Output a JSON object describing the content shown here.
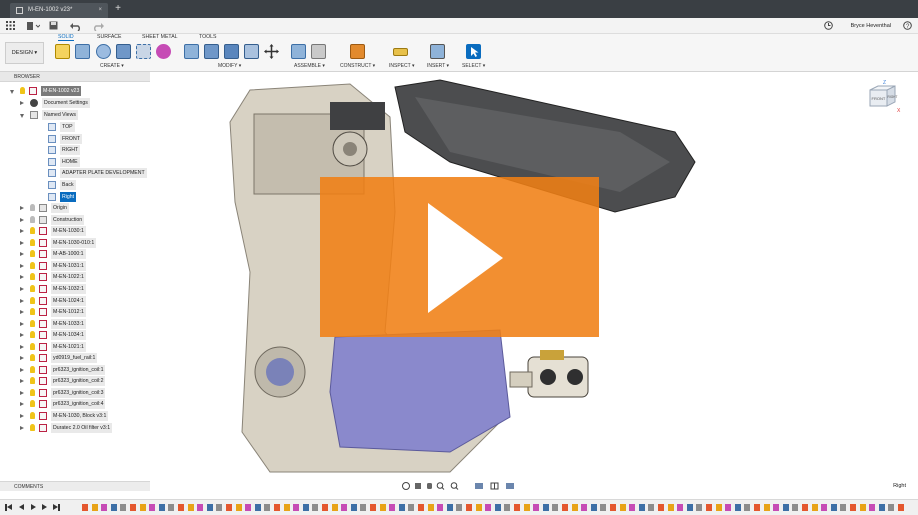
{
  "document_tab": {
    "title": "M-EN-1002 v23*",
    "close": "×",
    "new_tab": "+"
  },
  "user": {
    "name": "Bryce Heventhal"
  },
  "ribbon": {
    "workspace_button": "DESIGN ▾",
    "tabs": [
      "SOLID",
      "SURFACE",
      "SHEET METAL",
      "TOOLS"
    ],
    "groups": [
      "CREATE ▾",
      "MODIFY ▾",
      "ASSEMBLE ▾",
      "CONSTRUCT ▾",
      "INSPECT ▾",
      "INSERT ▾",
      "SELECT ▾"
    ]
  },
  "browser": {
    "title": "BROWSER",
    "root": "M-EN-1002 v23",
    "document_settings": "Document Settings",
    "named_views": "Named Views",
    "views": [
      "TOP",
      "FRONT",
      "RIGHT",
      "HOME",
      "ADAPTER PLATE DEVELOPMENT",
      "Back",
      "Right"
    ],
    "selected_view": "Right",
    "folders": [
      "Origin",
      "Construction"
    ],
    "components": [
      "M-EN-1030:1",
      "M-EN-1030-010:1",
      "M-AB-1000:1",
      "M-EN-1031:1",
      "M-EN-1022:1",
      "M-EN-1032:1",
      "M-EN-1024:1",
      "M-EN-1012:1",
      "M-EN-1033:1",
      "M-EN-1034:1",
      "M-EN-1021:1",
      "yd0919_fuel_rail:1",
      "pr6323_ignition_coil:1",
      "pr6323_ignition_coil:2",
      "pr6323_ignition_coil:3",
      "pr6323_ignition_coil:4",
      "M-EN-1030, Block v3:1",
      "Duratec 2.0 Oil filter v3:1"
    ]
  },
  "viewcube": {
    "front": "FRONT",
    "right": "RIGHT",
    "axis_z": "Z",
    "axis_x": "X"
  },
  "comments": "COMMENTS",
  "current_view": "Right",
  "colors": {
    "accent": "#0a6cbf",
    "play_overlay": "#f08014",
    "titlebar": "#3a3f44"
  }
}
